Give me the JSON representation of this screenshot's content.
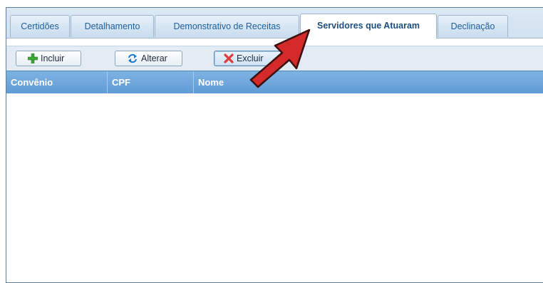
{
  "tabs": [
    {
      "label": "Certidões",
      "active": false
    },
    {
      "label": "Detalhamento",
      "active": false
    },
    {
      "label": "Demonstrativo de Receitas",
      "active": false
    },
    {
      "label": "Servidores que Atuaram",
      "active": true
    },
    {
      "label": "Declinação",
      "active": false
    }
  ],
  "toolbar": {
    "incluir_label": "Incluir",
    "alterar_label": "Alterar",
    "excluir_label": "Excluir"
  },
  "grid": {
    "columns": [
      "Convênio",
      "CPF",
      "Nome"
    ],
    "rows": []
  },
  "icons": {
    "incluir": "plus-icon",
    "alterar": "refresh-icon",
    "excluir": "x-icon",
    "annotation": "red-arrow-icon"
  },
  "colors": {
    "tab_text": "#1f5f9a",
    "header_bg": "#6aa6dd",
    "plus_green": "#3aa935",
    "refresh_blue": "#1e7ad0",
    "delete_red": "#e03a3a",
    "arrow_red": "#d42a2a"
  }
}
